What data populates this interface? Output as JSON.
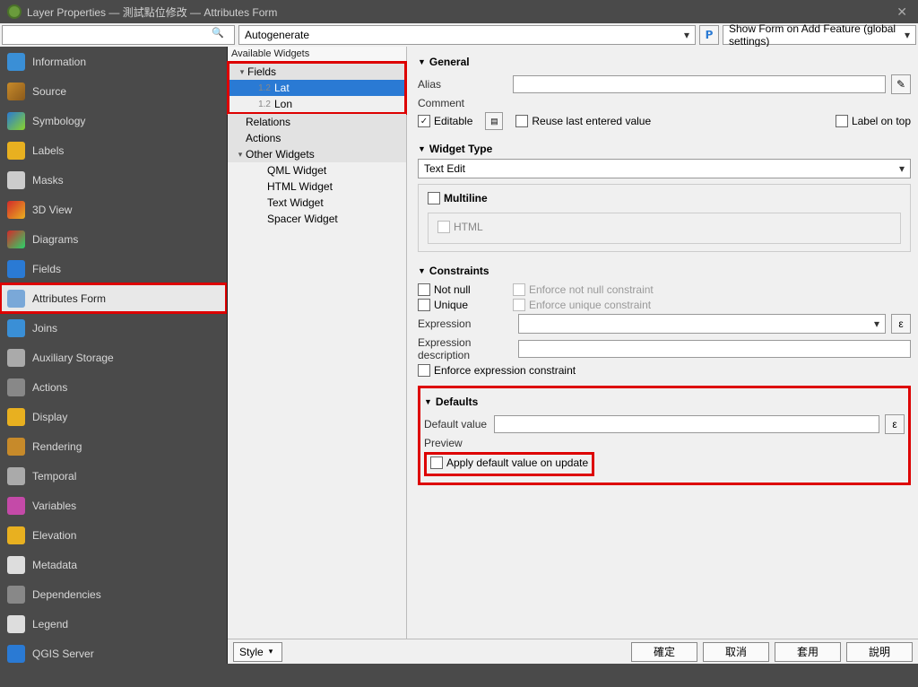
{
  "window": {
    "title": "Layer Properties — 測試點位修改 — Attributes Form"
  },
  "topbar": {
    "mode_combo": "Autogenerate",
    "form_setting": "Show Form on Add Feature (global settings)"
  },
  "sidebar": {
    "items": [
      {
        "label": "Information",
        "icon": "info-icon"
      },
      {
        "label": "Source",
        "icon": "source-icon"
      },
      {
        "label": "Symbology",
        "icon": "symbology-icon"
      },
      {
        "label": "Labels",
        "icon": "labels-icon"
      },
      {
        "label": "Masks",
        "icon": "masks-icon"
      },
      {
        "label": "3D View",
        "icon": "3d-icon"
      },
      {
        "label": "Diagrams",
        "icon": "diagrams-icon"
      },
      {
        "label": "Fields",
        "icon": "fields-icon"
      },
      {
        "label": "Attributes Form",
        "icon": "attr-form-icon",
        "active": true,
        "highlighted": true
      },
      {
        "label": "Joins",
        "icon": "joins-icon"
      },
      {
        "label": "Auxiliary Storage",
        "icon": "aux-icon"
      },
      {
        "label": "Actions",
        "icon": "actions-icon"
      },
      {
        "label": "Display",
        "icon": "display-icon"
      },
      {
        "label": "Rendering",
        "icon": "rendering-icon"
      },
      {
        "label": "Temporal",
        "icon": "temporal-icon"
      },
      {
        "label": "Variables",
        "icon": "variables-icon"
      },
      {
        "label": "Elevation",
        "icon": "elevation-icon"
      },
      {
        "label": "Metadata",
        "icon": "metadata-icon"
      },
      {
        "label": "Dependencies",
        "icon": "deps-icon"
      },
      {
        "label": "Legend",
        "icon": "legend-icon"
      },
      {
        "label": "QGIS Server",
        "icon": "qgis-server-icon"
      }
    ]
  },
  "tree": {
    "header": "Available Widgets",
    "fields_label": "Fields",
    "fields": [
      {
        "type": "1.2",
        "name": "Lat",
        "selected": true
      },
      {
        "type": "1.2",
        "name": "Lon"
      }
    ],
    "relations": "Relations",
    "actions": "Actions",
    "other_label": "Other Widgets",
    "other": [
      "QML Widget",
      "HTML Widget",
      "Text Widget",
      "Spacer Widget"
    ]
  },
  "form": {
    "general": {
      "title": "General",
      "alias_lbl": "Alias",
      "comment_lbl": "Comment",
      "editable_lbl": "Editable",
      "reuse_lbl": "Reuse last entered value",
      "labelontop_lbl": "Label on top"
    },
    "widget": {
      "title": "Widget Type",
      "combo": "Text Edit",
      "multiline": "Multiline",
      "html": "HTML"
    },
    "constraints": {
      "title": "Constraints",
      "notnull": "Not null",
      "enf_notnull": "Enforce not null constraint",
      "unique": "Unique",
      "enf_unique": "Enforce unique constraint",
      "expr_lbl": "Expression",
      "expr_desc_lbl": "Expression description",
      "enf_expr": "Enforce expression constraint"
    },
    "defaults": {
      "title": "Defaults",
      "defval_lbl": "Default value",
      "preview_lbl": "Preview",
      "apply_update": "Apply default value on update"
    }
  },
  "buttons": {
    "style": "Style",
    "ok": "確定",
    "cancel": "取消",
    "apply": "套用",
    "help": "說明"
  },
  "epsilon": "ε"
}
